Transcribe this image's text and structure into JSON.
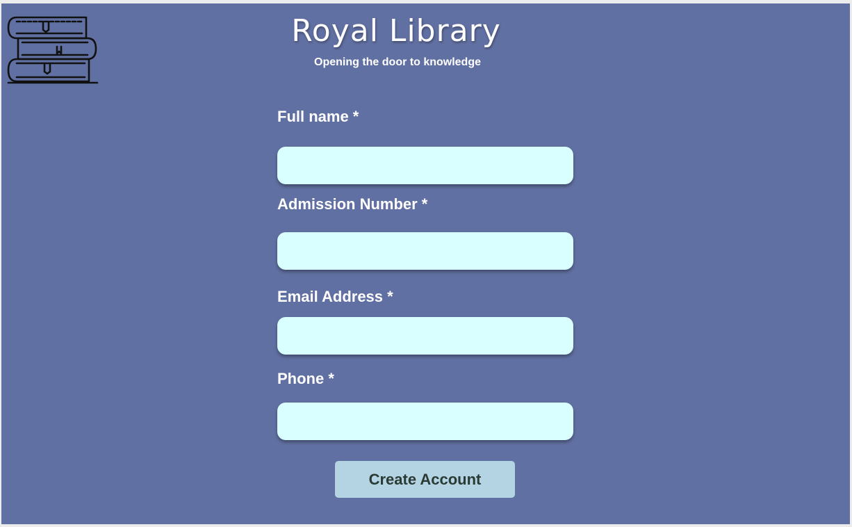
{
  "header": {
    "logo_icon": "stacked-books-icon",
    "title": "Royal Library",
    "subtitle": "Opening the door to knowledge"
  },
  "form": {
    "fields": [
      {
        "label": "Full name *",
        "value": "",
        "placeholder": ""
      },
      {
        "label": "Admission Number *",
        "value": "",
        "placeholder": ""
      },
      {
        "label": "Email Address *",
        "value": "",
        "placeholder": ""
      },
      {
        "label": "Phone *",
        "value": "",
        "placeholder": ""
      }
    ],
    "submit_label": "Create Account"
  },
  "colors": {
    "background": "#6170a2",
    "input_background": "#daffff",
    "button_background": "#b4d4e3",
    "text": "#ffffff"
  }
}
